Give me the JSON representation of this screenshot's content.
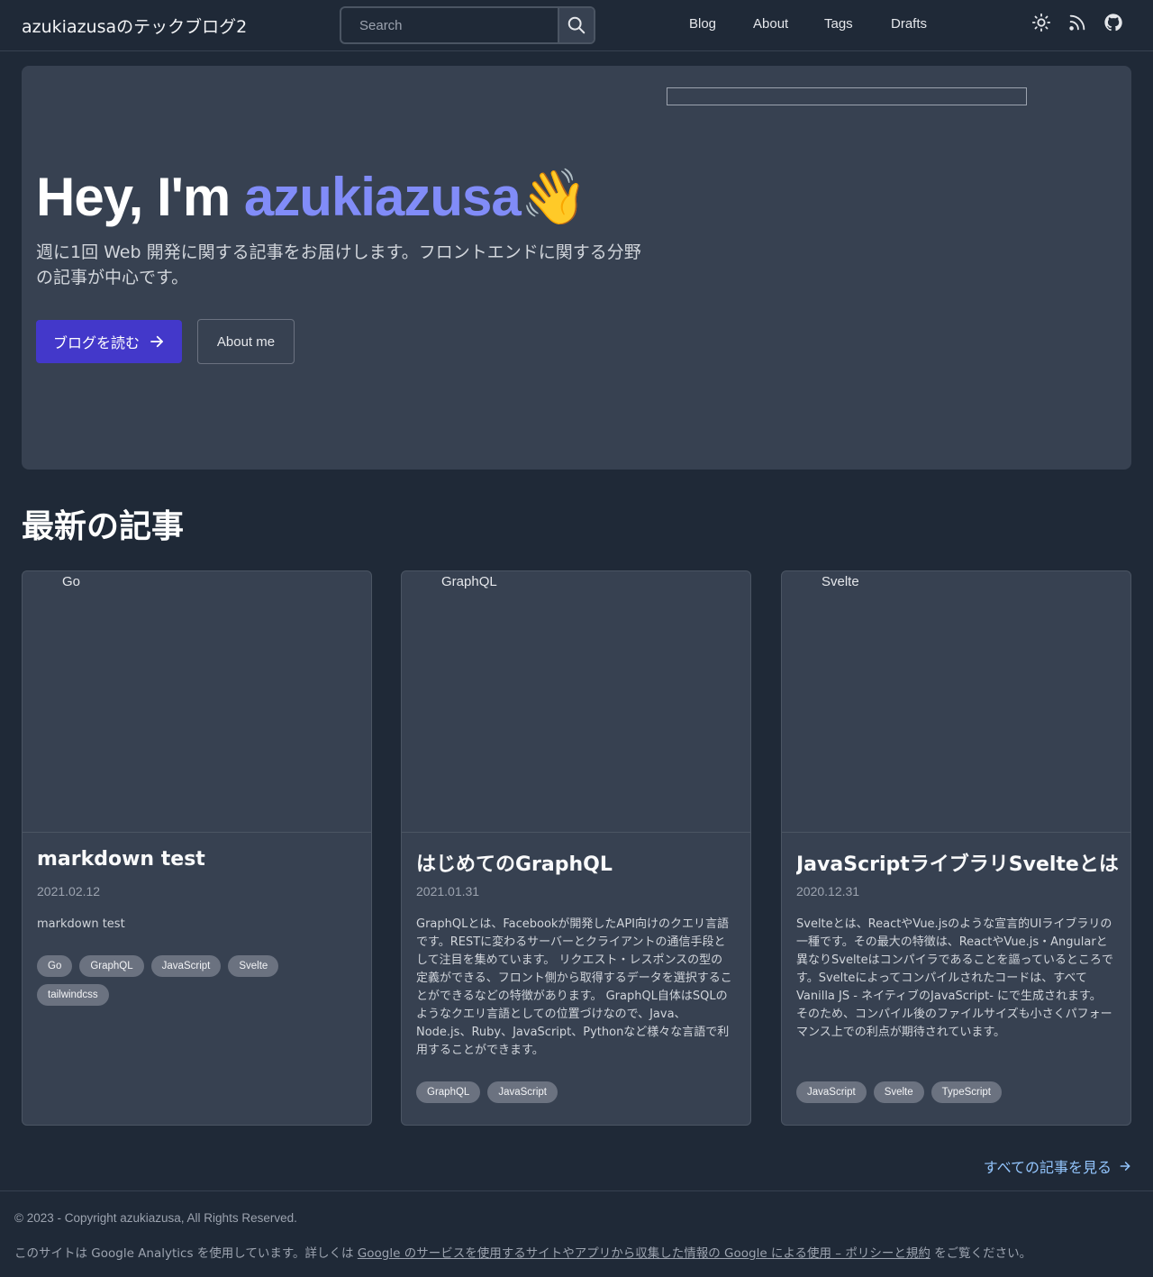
{
  "header": {
    "site_title": "azukiazusaのテックブログ2",
    "search_placeholder": "Search",
    "nav": [
      "Blog",
      "About",
      "Tags",
      "Drafts"
    ],
    "icons": [
      "sun-icon",
      "rss-icon",
      "github-icon"
    ]
  },
  "hero": {
    "greeting": "Hey, I'm ",
    "name": "azukiazusa",
    "emoji": "👋",
    "description": "週に1回 Web 開発に関する記事をお届けします。フロントエンドに関する分野の記事が中心です。",
    "primary_button": "ブログを読む",
    "secondary_button": "About me"
  },
  "latest": {
    "title": "最新の記事",
    "see_all": "すべての記事を見る"
  },
  "articles": [
    {
      "image_alt": "Go",
      "title": "markdown test",
      "date": "2021.02.12",
      "excerpt": "markdown test",
      "tags": [
        "Go",
        "GraphQL",
        "JavaScript",
        "Svelte",
        "tailwindcss"
      ]
    },
    {
      "image_alt": "GraphQL",
      "title": "はじめてのGraphQL",
      "date": "2021.01.31",
      "excerpt": "GraphQLとは、Facebookが開発したAPI向けのクエリ言語です。RESTに変わるサーバーとクライアントの通信手段として注目を集めています。 リクエスト・レスポンスの型の定義ができる、フロント側から取得するデータを選択することができるなどの特徴があります。 GraphQL自体はSQLのようなクエリ言語としての位置づけなので、Java、Node.js、Ruby、JavaScript、Pythonなど様々な言語で利用することができます。",
      "tags": [
        "GraphQL",
        "JavaScript"
      ]
    },
    {
      "image_alt": "Svelte",
      "title": "JavaScriptライブラリSvelteとは",
      "date": "2020.12.31",
      "excerpt": "Svelteとは、ReactやVue.jsのような宣言的UIライブラリの一種です。その最大の特徴は、ReactやVue.js・Angularと異なりSvelteはコンパイラであることを謳っているところです。Svelteによってコンパイルされたコードは、すべてVanilla JS - ネイティブのJavaScript- にで生成されます。 そのため、コンパイル後のファイルサイズも小さくパフォーマンス上での利点が期待されています。",
      "tags": [
        "JavaScript",
        "Svelte",
        "TypeScript"
      ]
    }
  ],
  "footer": {
    "copyright": "© 2023 - Copyright azukiazusa, All Rights Reserved.",
    "ga_prefix": "このサイトは Google Analytics を使用しています。詳しくは ",
    "ga_link": "Google のサービスを使用するサイトやアプリから収集した情報の Google による使用 – ポリシーと規約",
    "ga_suffix": " をご覧ください。"
  },
  "colors": {
    "background": "#1f2937",
    "surface": "#374151",
    "accent": "#818cf8",
    "primary_button": "#4338ca",
    "link": "#93c5fd"
  }
}
